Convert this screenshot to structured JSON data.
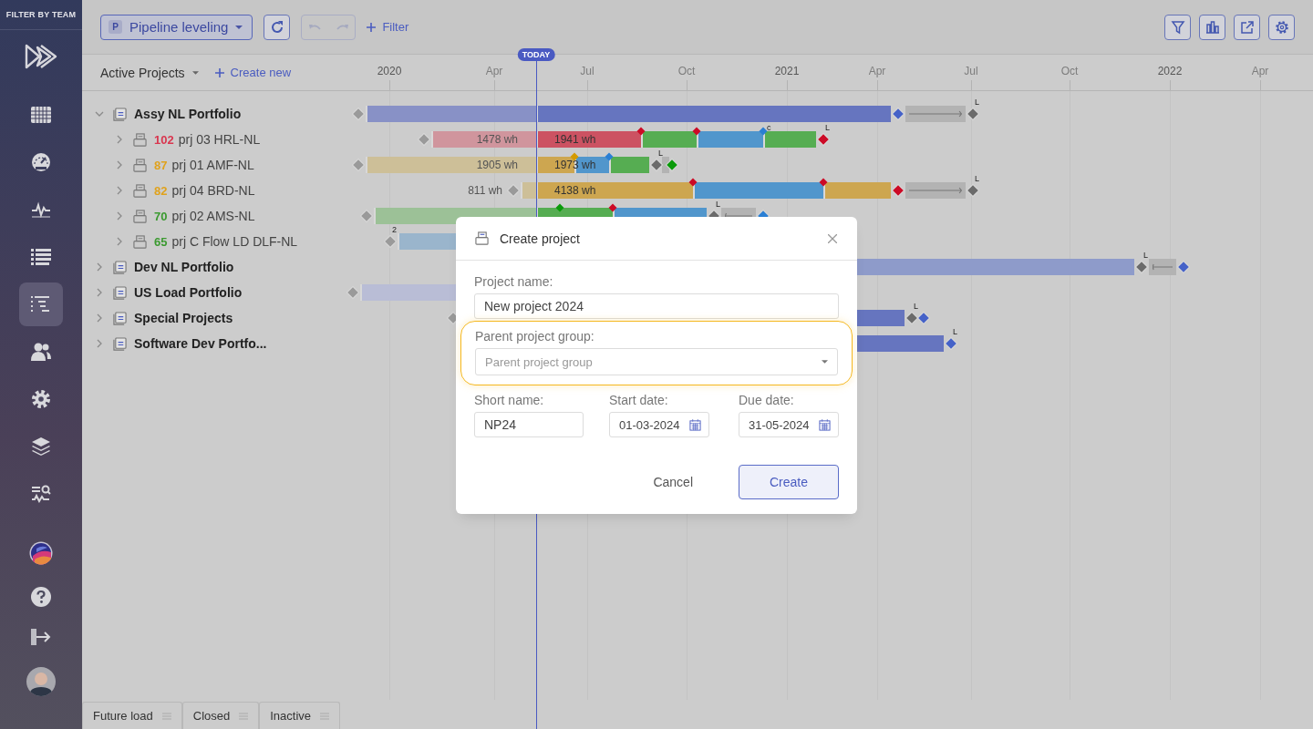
{
  "sidebar": {
    "heading": "FILTER BY TEAM",
    "nav": [
      {
        "selected": false
      },
      {
        "selected": false
      },
      {
        "selected": false
      },
      {
        "selected": false
      },
      {
        "selected": true
      },
      {
        "selected": false
      },
      {
        "selected": false
      },
      {
        "selected": false
      },
      {
        "selected": false
      }
    ]
  },
  "toolbar": {
    "view": {
      "badge": "P",
      "label": "Pipeline leveling"
    },
    "history_disabled": true,
    "filter": "Filter"
  },
  "project_list": {
    "title": "Active Projects",
    "create": "Create new"
  },
  "timeline": {
    "today": "TODAY",
    "ticks": [
      {
        "label": "2020",
        "kind": "year"
      },
      {
        "label": "Apr",
        "kind": "month"
      },
      {
        "label": "Jul",
        "kind": "month"
      },
      {
        "label": "Oct",
        "kind": "month"
      },
      {
        "label": "2021",
        "kind": "year"
      },
      {
        "label": "Apr",
        "kind": "month"
      },
      {
        "label": "Jul",
        "kind": "month"
      },
      {
        "label": "Oct",
        "kind": "month"
      },
      {
        "label": "2022",
        "kind": "year"
      },
      {
        "label": "Apr",
        "kind": "month"
      }
    ]
  },
  "projects": [
    {
      "name": "Assy NL Portfolio",
      "expanded": true,
      "gantt": {
        "segments": [
          {
            "color": "#8891c6"
          },
          {
            "color": "#6675bf"
          }
        ],
        "slack": {
          "arrow": true,
          "reverse": false
        },
        "milestones": [
          {
            "kind": "endpoint",
            "color": "#9a9a9a"
          },
          {
            "kind": "endpoint",
            "color": "#4562c8"
          },
          {
            "kind": "endpoint",
            "color": "#6b6b6b",
            "note": "L"
          }
        ]
      },
      "children": [
        {
          "score": "102",
          "color": "#d9364f",
          "name": "prj 03 HRL-NL",
          "expanded": false,
          "gantt": {
            "segments": [
              {
                "color": "#d0959d",
                "label": "1478 wh"
              },
              {
                "color": "#cc5262",
                "label": "1941 wh"
              },
              {
                "color": "#56ad52"
              },
              {
                "color": "#5196cc"
              },
              {
                "color": "#56ad52"
              }
            ],
            "milestones": [
              {
                "kind": "endpoint",
                "color": "#9a9a9a"
              },
              {
                "kind": "marker",
                "color": "#cc0a26"
              },
              {
                "kind": "marker",
                "color": "#cc0a26"
              },
              {
                "kind": "marker",
                "color": "#2a7fd4",
                "note": "c"
              },
              {
                "kind": "endpoint",
                "color": "#cc0a26",
                "note": "L"
              }
            ]
          }
        },
        {
          "score": "87",
          "color": "#e0a21c",
          "name": "prj 01 AMF-NL",
          "expanded": false,
          "gantt": {
            "segments": [
              {
                "color": "#cdbf98",
                "label": "1905 wh"
              },
              {
                "color": "#cda650",
                "label": "1973 wh"
              },
              {
                "color": "#5196cc"
              },
              {
                "color": "#56ad52"
              }
            ],
            "slack": {
              "arrow": false
            },
            "milestones": [
              {
                "kind": "endpoint",
                "color": "#9a9a9a"
              },
              {
                "kind": "marker",
                "color": "#d49a00"
              },
              {
                "kind": "marker",
                "color": "#2a7fd4"
              },
              {
                "kind": "endpoint",
                "color": "#6b6b6b",
                "note": "L"
              },
              {
                "kind": "endpoint",
                "color": "#0a9a0a"
              }
            ]
          }
        },
        {
          "score": "82",
          "color": "#e0a21c",
          "name": "prj 04 BRD-NL",
          "expanded": false,
          "gantt": {
            "segments": [
              {
                "color": "#cdbf98",
                "label": "811 wh"
              },
              {
                "color": "#cda650",
                "label": "4138 wh"
              },
              {
                "color": "#5196cc"
              },
              {
                "color": "#cda650"
              }
            ],
            "slack": {
              "arrow": true,
              "reverse": false
            },
            "milestones": [
              {
                "kind": "endpoint",
                "color": "#9a9a9a"
              },
              {
                "kind": "marker",
                "color": "#cc0a26"
              },
              {
                "kind": "marker",
                "color": "#cc0a26"
              },
              {
                "kind": "endpoint",
                "color": "#cc0a26"
              },
              {
                "kind": "endpoint",
                "color": "#6b6b6b",
                "note": "L"
              }
            ]
          }
        },
        {
          "score": "70",
          "color": "#3b9a30",
          "name": "prj 02 AMS-NL",
          "expanded": false,
          "gantt": {
            "segments": [
              {
                "color": "#9cc197"
              },
              {
                "color": "#56ad52"
              },
              {
                "color": "#5196cc"
              }
            ],
            "slack": {
              "arrow": true,
              "reverse": true
            },
            "milestones": [
              {
                "kind": "endpoint",
                "color": "#9a9a9a"
              },
              {
                "kind": "marker",
                "color": "#0a9a0a"
              },
              {
                "kind": "marker",
                "color": "#cc0a26"
              },
              {
                "kind": "endpoint",
                "color": "#6b6b6b",
                "note": "L"
              },
              {
                "kind": "endpoint",
                "color": "#2a7fd4"
              }
            ]
          }
        },
        {
          "score": "65",
          "color": "#3b9a30",
          "name": "prj C Flow LD DLF-NL",
          "expanded": false,
          "gantt": {
            "segments": [
              {
                "color": "#9ab5cc"
              }
            ],
            "milestones": [
              {
                "kind": "endpoint",
                "color": "#9a9a9a",
                "note": "2"
              }
            ]
          }
        }
      ]
    },
    {
      "name": "Dev NL Portfolio",
      "expanded": false,
      "gantt": {
        "segments": [
          {
            "color": "#8e9bca"
          }
        ],
        "slack": {
          "arrow": true,
          "reverse": true
        },
        "milestones": [
          {
            "kind": "endpoint",
            "color": "#6b6b6b",
            "note": "L"
          },
          {
            "kind": "endpoint",
            "color": "#4562c8"
          }
        ]
      }
    },
    {
      "name": "US Load Portfolio",
      "expanded": false,
      "gantt": {
        "segments": [
          {
            "color": "#b9bdd6"
          }
        ],
        "milestones": [
          {
            "kind": "endpoint",
            "color": "#9a9a9a"
          }
        ]
      }
    },
    {
      "name": "Special Projects",
      "expanded": false,
      "gantt": {
        "segments": [
          {
            "color": "#6675bf"
          }
        ],
        "milestones": [
          {
            "kind": "endpoint",
            "color": "#9a9a9a"
          },
          {
            "kind": "endpoint",
            "color": "#6b6b6b",
            "note": "L"
          },
          {
            "kind": "endpoint",
            "color": "#4562c8"
          }
        ]
      }
    },
    {
      "name": "Software Dev Portfo...",
      "expanded": false,
      "gantt": {
        "segments": [
          {
            "color": "#6675bf"
          }
        ],
        "milestones": [
          {
            "kind": "endpoint",
            "color": "#4562c8",
            "note": "L"
          }
        ]
      }
    }
  ],
  "modal": {
    "title": "Create project",
    "project_name": {
      "label": "Project name:",
      "value": "New project 2024"
    },
    "parent_group": {
      "label": "Parent project group:",
      "placeholder": "Parent project group",
      "focused": true
    },
    "short_name": {
      "label": "Short name:",
      "value": "NP24"
    },
    "start_date": {
      "label": "Start date:",
      "value": "01-03-2024"
    },
    "due_date": {
      "label": "Due date:",
      "value": "31-05-2024"
    },
    "cancel": "Cancel",
    "create": "Create"
  },
  "bottom_tabs": [
    {
      "label": "Future load"
    },
    {
      "label": "Closed"
    },
    {
      "label": "Inactive"
    }
  ]
}
